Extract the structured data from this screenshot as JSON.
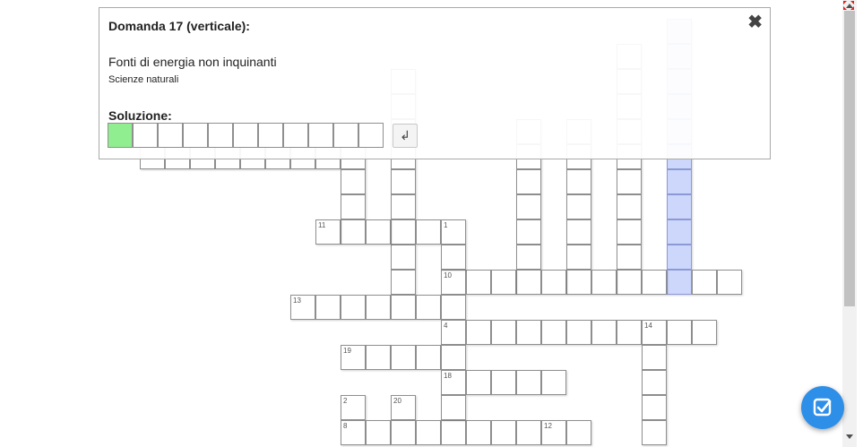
{
  "panel": {
    "question_title": "Domanda 17 (verticale):",
    "clue": "Fonti di energia non inquinanti",
    "category": "Scienze naturali",
    "solution_label": "Soluzione:",
    "answer_length": 11,
    "enter_symbol": "↲",
    "close_symbol": "✖"
  },
  "grid": {
    "numbers": [
      "11",
      "1",
      "10",
      "13",
      "4",
      "14",
      "19",
      "18",
      "2",
      "20",
      "8",
      "12"
    ]
  },
  "colors": {
    "highlight": "#ccd7fb",
    "answer_active": "#90ee90",
    "fab": "#2d8fe8"
  },
  "icons": {
    "close": "close-icon",
    "enter": "enter-icon",
    "check": "check-icon",
    "fullscreen": "fullscreen-icon"
  }
}
